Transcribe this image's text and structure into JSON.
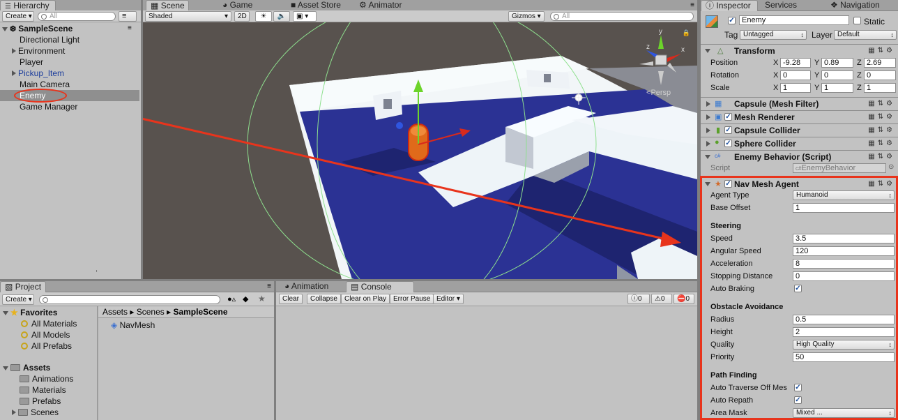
{
  "hierarchy": {
    "tab": "Hierarchy",
    "create": "Create",
    "search_placeholder": "All",
    "scene": "SampleScene",
    "items": [
      "Directional Light",
      "Environment",
      "Player",
      "Pickup_Item",
      "Main Camera",
      "Enemy",
      "Game Manager"
    ],
    "dot": "."
  },
  "scene": {
    "tabs": [
      "Scene",
      "Game",
      "Asset Store",
      "Animator"
    ],
    "shading": "Shaded",
    "mode_2d": "2D",
    "gizmos": "Gizmos",
    "search_placeholder": "All",
    "persp": "Persp",
    "axis_x": "x",
    "axis_y": "y",
    "axis_z": "z"
  },
  "inspector": {
    "tabs": [
      "Inspector",
      "Services",
      "Navigation"
    ],
    "object_name": "Enemy",
    "static_label": "Static",
    "tag_label": "Tag",
    "tag_value": "Untagged",
    "layer_label": "Layer",
    "layer_value": "Default",
    "transform": {
      "title": "Transform",
      "rows": [
        {
          "label": "Position",
          "x": "-9.28",
          "y": "0.89",
          "z": "2.69"
        },
        {
          "label": "Rotation",
          "x": "0",
          "y": "0",
          "z": "0"
        },
        {
          "label": "Scale",
          "x": "1",
          "y": "1",
          "z": "1"
        }
      ],
      "axis": [
        "X",
        "Y",
        "Z"
      ]
    },
    "components": [
      "Capsule (Mesh Filter)",
      "Mesh Renderer",
      "Capsule Collider",
      "Sphere Collider",
      "Enemy Behavior (Script)"
    ],
    "script_label": "Script",
    "script_value": "EnemyBehavior",
    "nav_mesh_agent": {
      "title": "Nav Mesh Agent",
      "agent_type_label": "Agent Type",
      "agent_type_value": "Humanoid",
      "base_offset_label": "Base Offset",
      "base_offset_value": "1",
      "steering": "Steering",
      "speed_label": "Speed",
      "speed_value": "3.5",
      "angular_label": "Angular Speed",
      "angular_value": "120",
      "accel_label": "Acceleration",
      "accel_value": "8",
      "stopping_label": "Stopping Distance",
      "stopping_value": "0",
      "auto_braking_label": "Auto Braking",
      "obstacle": "Obstacle Avoidance",
      "radius_label": "Radius",
      "radius_value": "0.5",
      "height_label": "Height",
      "height_value": "2",
      "quality_label": "Quality",
      "quality_value": "High Quality",
      "priority_label": "Priority",
      "priority_value": "50",
      "path_finding": "Path Finding",
      "auto_traverse_label": "Auto Traverse Off Mes",
      "auto_repath_label": "Auto Repath",
      "area_mask_label": "Area Mask",
      "area_mask_value": "Mixed ..."
    }
  },
  "project": {
    "tab": "Project",
    "create": "Create",
    "favorites": "Favorites",
    "fav_items": [
      "All Materials",
      "All Models",
      "All Prefabs"
    ],
    "assets": "Assets",
    "asset_items": [
      "Animations",
      "Materials",
      "Prefabs",
      "Scenes"
    ],
    "breadcrumb": [
      "Assets",
      "Scenes",
      "SampleScene"
    ],
    "file": "NavMesh"
  },
  "console": {
    "tabs": [
      "Animation",
      "Console"
    ],
    "buttons": [
      "Clear",
      "Collapse",
      "Clear on Play",
      "Error Pause",
      "Editor"
    ],
    "counts": [
      "0",
      "0",
      "0"
    ]
  },
  "colors": {
    "highlight": "#e8341c",
    "selection": "#8f8f8f",
    "navmesh": "#2b3294"
  }
}
